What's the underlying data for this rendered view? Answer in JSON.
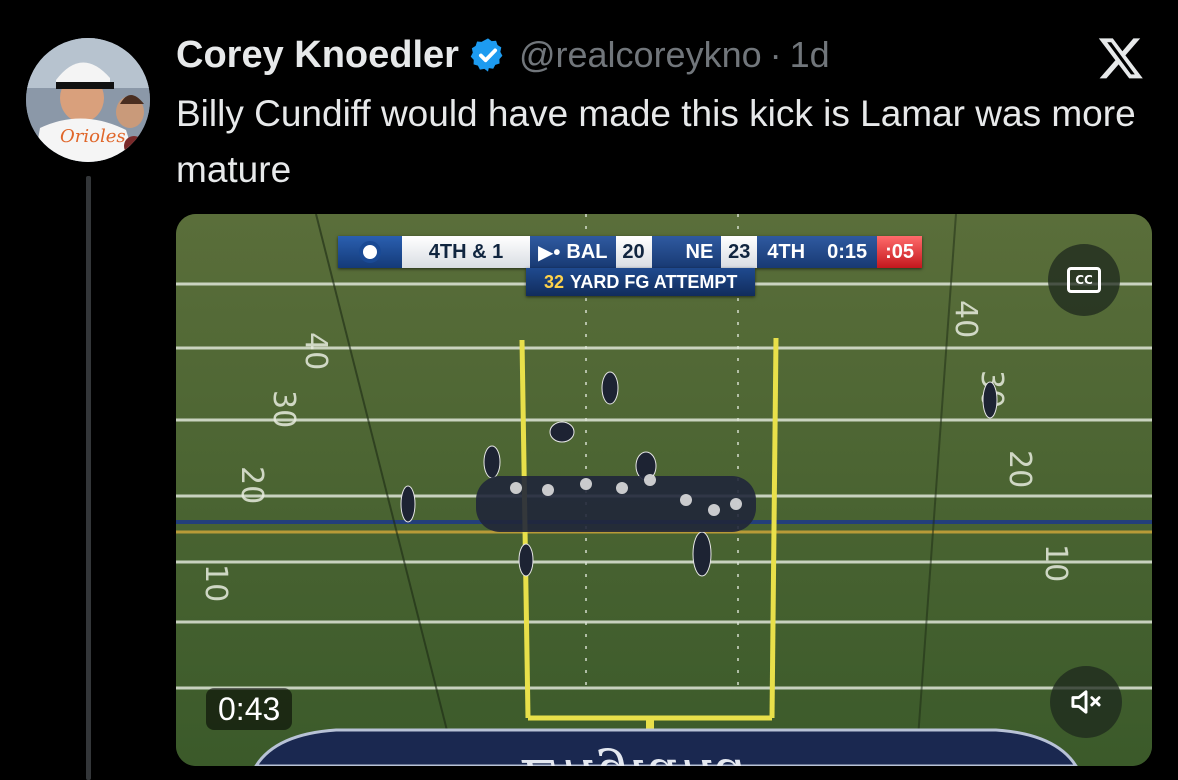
{
  "tweet": {
    "author_name": "Corey Knoedler",
    "handle": "@realcoreykno",
    "separator": "·",
    "time": "1d",
    "text": "Billy Cundiff would have made this kick is Lamar was more mature"
  },
  "avatar": {
    "cap_text": "Orioles"
  },
  "media": {
    "duration": "0:43",
    "cc_label": "CC",
    "scorebug": {
      "down": "4TH & 1",
      "away_team": "BAL",
      "away_score": "20",
      "home_team": "NE",
      "home_score": "23",
      "quarter": "4TH",
      "clock": "0:15",
      "play_clock": ":05",
      "subtitle_number": "32",
      "subtitle_text": "YARD FG ATTEMPT"
    },
    "yard_numbers_left": [
      "40",
      "30",
      "20",
      "10"
    ],
    "yard_numbers_right": [
      "40",
      "30",
      "20",
      "10"
    ],
    "endzone_text": "England"
  },
  "colors": {
    "verified": "#1d9bf0",
    "secondary_text": "#71767b",
    "field": "#3f5c2d",
    "goalpost": "#e8e04a"
  }
}
